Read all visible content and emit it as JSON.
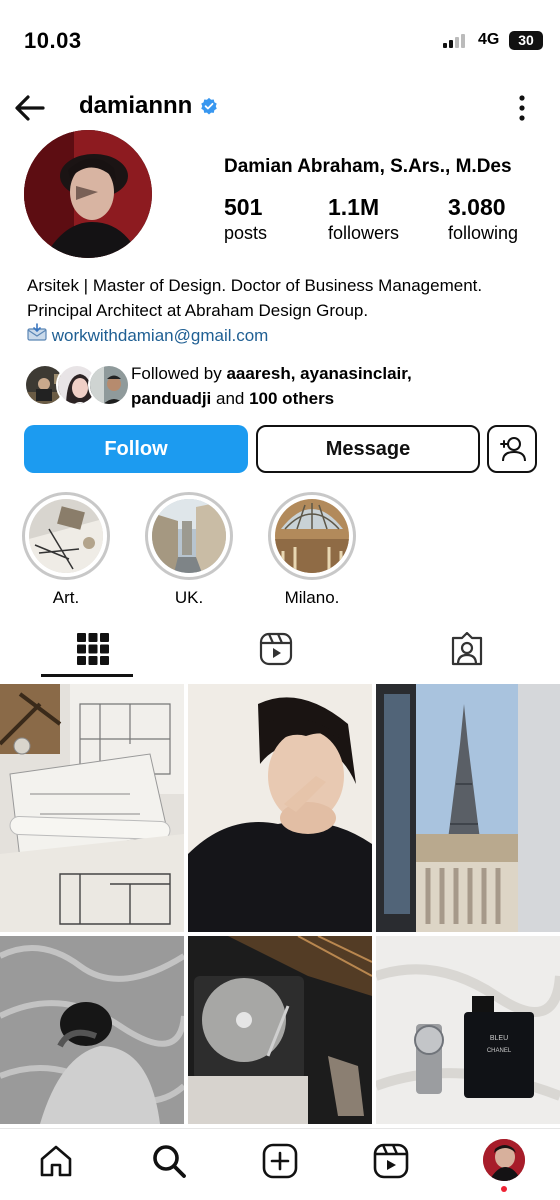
{
  "status_bar": {
    "time": "10.03",
    "network": "4G",
    "battery": "30"
  },
  "header": {
    "username": "damiannn"
  },
  "profile": {
    "full_name": "Damian Abraham, S.Ars., M.Des",
    "stats": [
      {
        "value": "501",
        "label": "posts"
      },
      {
        "value": "1.1M",
        "label": "followers"
      },
      {
        "value": "3.080",
        "label": "following"
      }
    ],
    "bio_line1": "Arsitek | Master of Design. Doctor of Business Management.",
    "bio_line2": "Principal Architect at Abraham Design Group.",
    "email": "workwithdamian@gmail.com"
  },
  "followed_by": {
    "prefix": "Followed by ",
    "names": "aaaresh, ayanasinclair,",
    "names2": "panduadji",
    "and": " and ",
    "others": "100 others"
  },
  "buttons": {
    "follow": "Follow",
    "message": "Message"
  },
  "highlights": [
    {
      "label": "Art."
    },
    {
      "label": "UK."
    },
    {
      "label": "Milano."
    }
  ],
  "colors": {
    "follow_blue": "#1c9bf0",
    "link_blue": "#1f5f93",
    "verified_blue": "#3897f0"
  },
  "icons": {
    "back": "arrow-left-icon",
    "more": "more-vertical-icon",
    "grid_tab": "grid-icon",
    "reels_tab": "reels-icon",
    "tagged_tab": "tagged-icon",
    "home": "home-icon",
    "search": "search-icon",
    "create": "create-icon",
    "reels": "reels-icon"
  }
}
